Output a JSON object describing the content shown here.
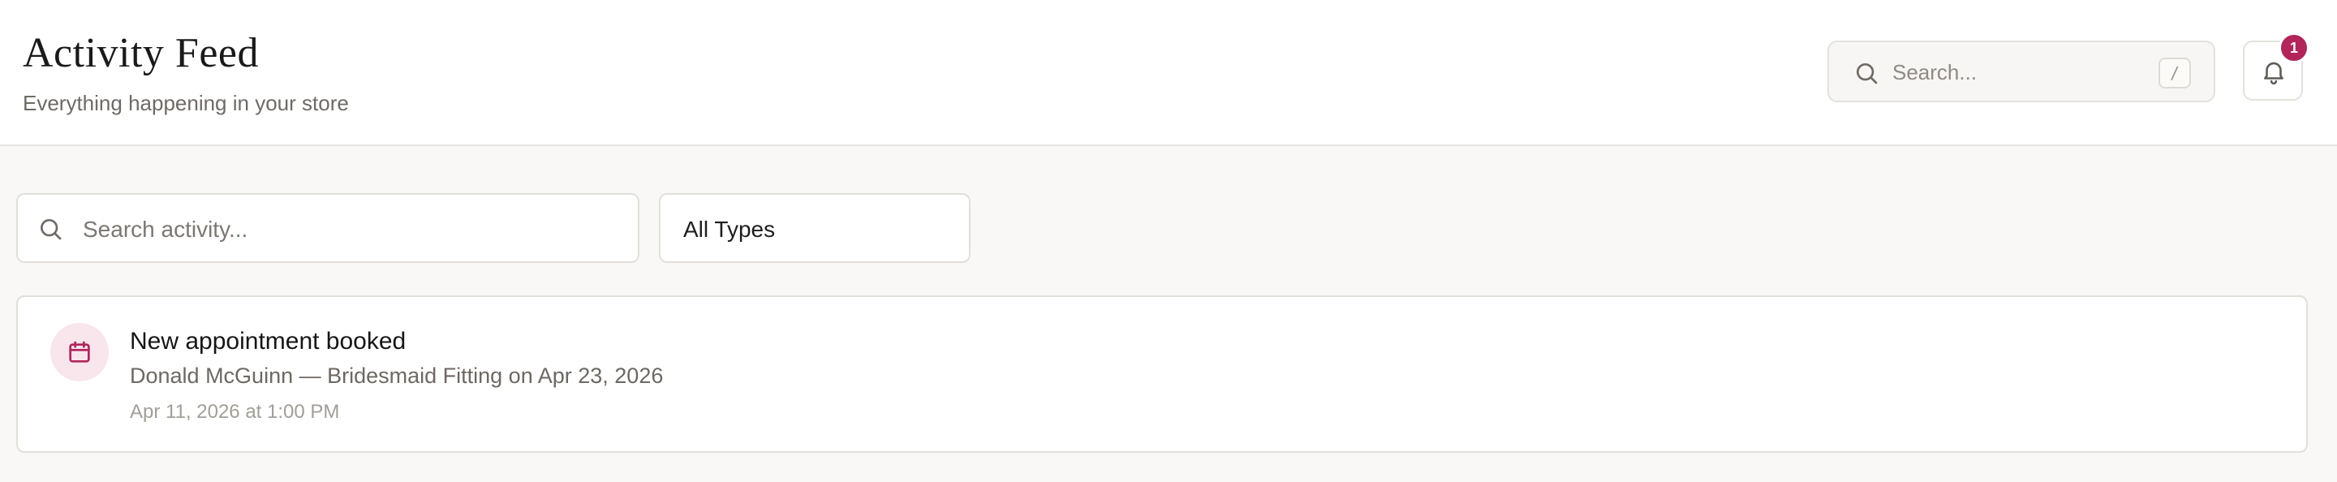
{
  "header": {
    "title": "Activity Feed",
    "subtitle": "Everything happening in your store",
    "search": {
      "placeholder": "Search...",
      "shortcut": "/",
      "icon": "search-icon"
    },
    "notifications": {
      "icon": "bell-icon",
      "count": "1"
    }
  },
  "filters": {
    "search_placeholder": "Search activity...",
    "type_selected": "All Types"
  },
  "activities": [
    {
      "icon": "calendar-icon",
      "title": "New appointment booked",
      "description": "Donald McGuinn — Bridesmaid Fitting on Apr 23, 2026",
      "timestamp": "Apr 11, 2026 at 1:00 PM"
    }
  ],
  "colors": {
    "accent": "#b2245a",
    "accent_soft": "#f8e6ec",
    "background": "#f9f8f6"
  }
}
